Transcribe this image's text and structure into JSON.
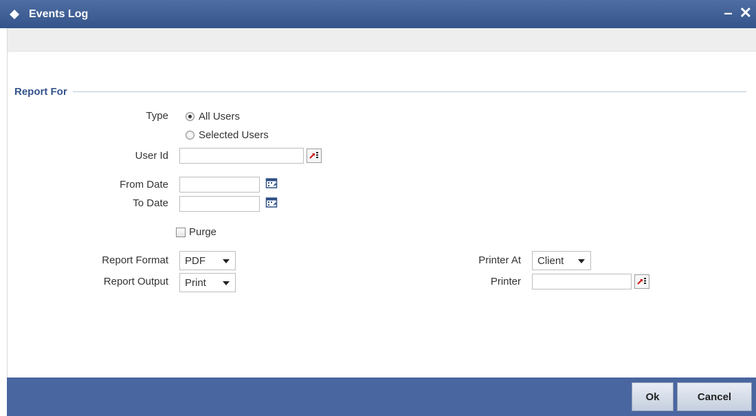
{
  "window": {
    "title": "Events Log",
    "minimize_glyph": "–",
    "close_glyph": "✕"
  },
  "section": {
    "legend": "Report For"
  },
  "form": {
    "type_label": "Type",
    "type_options": [
      "All Users",
      "Selected Users"
    ],
    "type_selected": "All Users",
    "user_id_label": "User Id",
    "user_id_value": "",
    "from_date_label": "From Date",
    "from_date_value": "",
    "to_date_label": "To Date",
    "to_date_value": "",
    "purge_label": "Purge",
    "purge_checked": false,
    "report_format_label": "Report Format",
    "report_format_value": "PDF",
    "report_output_label": "Report Output",
    "report_output_value": "Print",
    "printer_at_label": "Printer At",
    "printer_at_value": "Client",
    "printer_label": "Printer",
    "printer_value": ""
  },
  "footer": {
    "ok_label": "Ok",
    "cancel_label": "Cancel"
  },
  "colors": {
    "titlebar": "#33538a",
    "footer": "#4a66a0",
    "legend": "#33538a",
    "lov_arrow": "#cc1111"
  },
  "icons": {
    "title": "diamond-icon",
    "lov": "lov-arrow-icon",
    "calendar": "calendar-icon"
  }
}
